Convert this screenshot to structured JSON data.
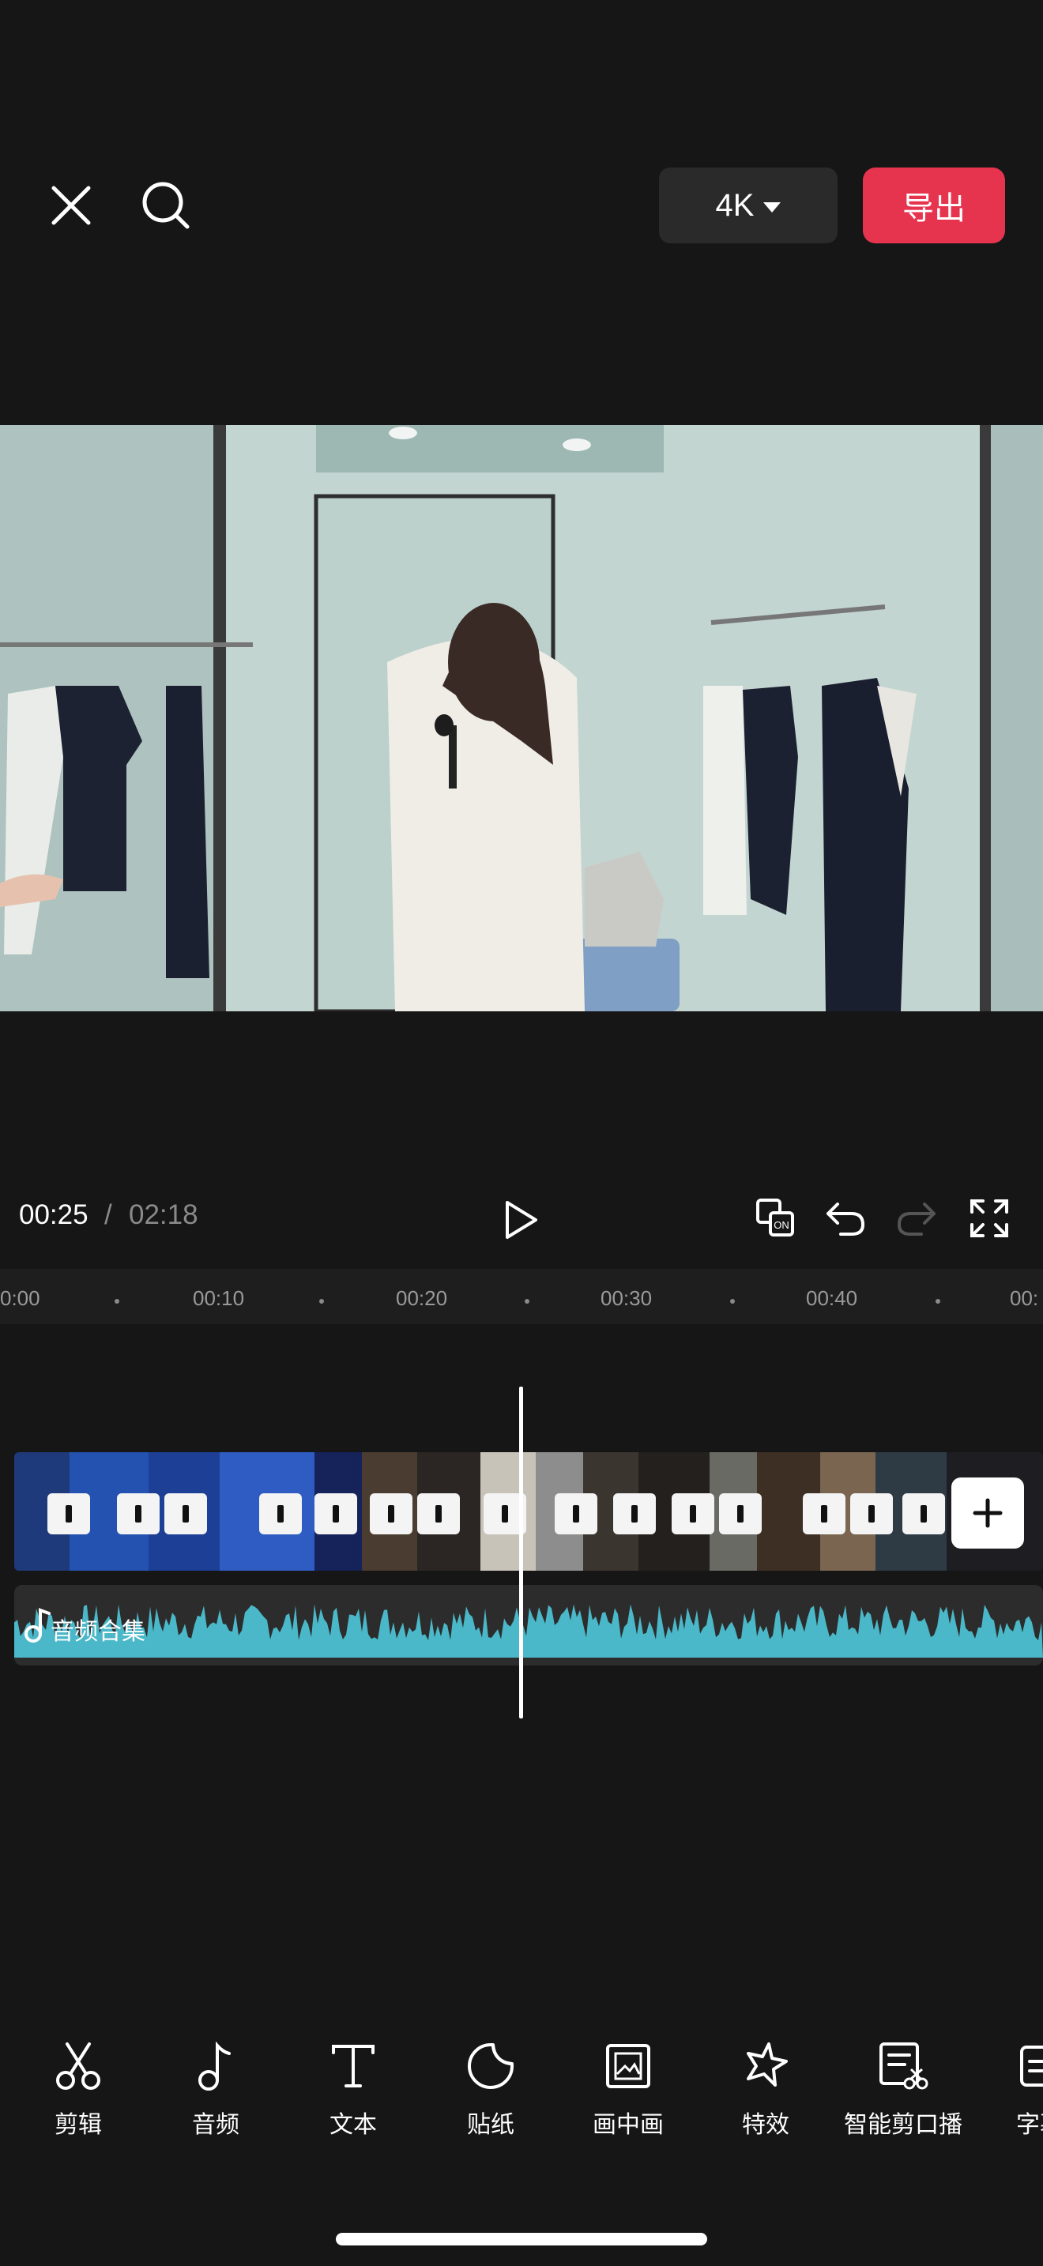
{
  "header": {
    "close_icon": "close-icon",
    "search_icon": "search-icon",
    "quality_label": "4K",
    "export_label": "导出",
    "export_color": "#e6344f"
  },
  "playback": {
    "current_time": "00:25",
    "separator": "/",
    "total_time": "02:18",
    "controls": [
      "play-icon",
      "auto-caption-on-icon",
      "undo-icon",
      "redo-icon",
      "fullscreen-icon"
    ]
  },
  "ruler": {
    "ticks": [
      "0:00",
      "00:10",
      "00:20",
      "00:30",
      "00:40",
      "00:"
    ]
  },
  "timeline": {
    "audio_label": "音频合集",
    "audio_wave_color": "#4ab8c8"
  },
  "toolbar": {
    "items": [
      {
        "label": "剪辑",
        "icon": "scissors-icon"
      },
      {
        "label": "音频",
        "icon": "music-note-icon"
      },
      {
        "label": "文本",
        "icon": "text-icon"
      },
      {
        "label": "贴纸",
        "icon": "sticker-icon"
      },
      {
        "label": "画中画",
        "icon": "picture-in-picture-icon"
      },
      {
        "label": "特效",
        "icon": "effects-star-icon"
      },
      {
        "label": "智能剪口播",
        "icon": "smart-edit-icon"
      },
      {
        "label": "字幕",
        "icon": "subtitle-icon"
      }
    ]
  }
}
